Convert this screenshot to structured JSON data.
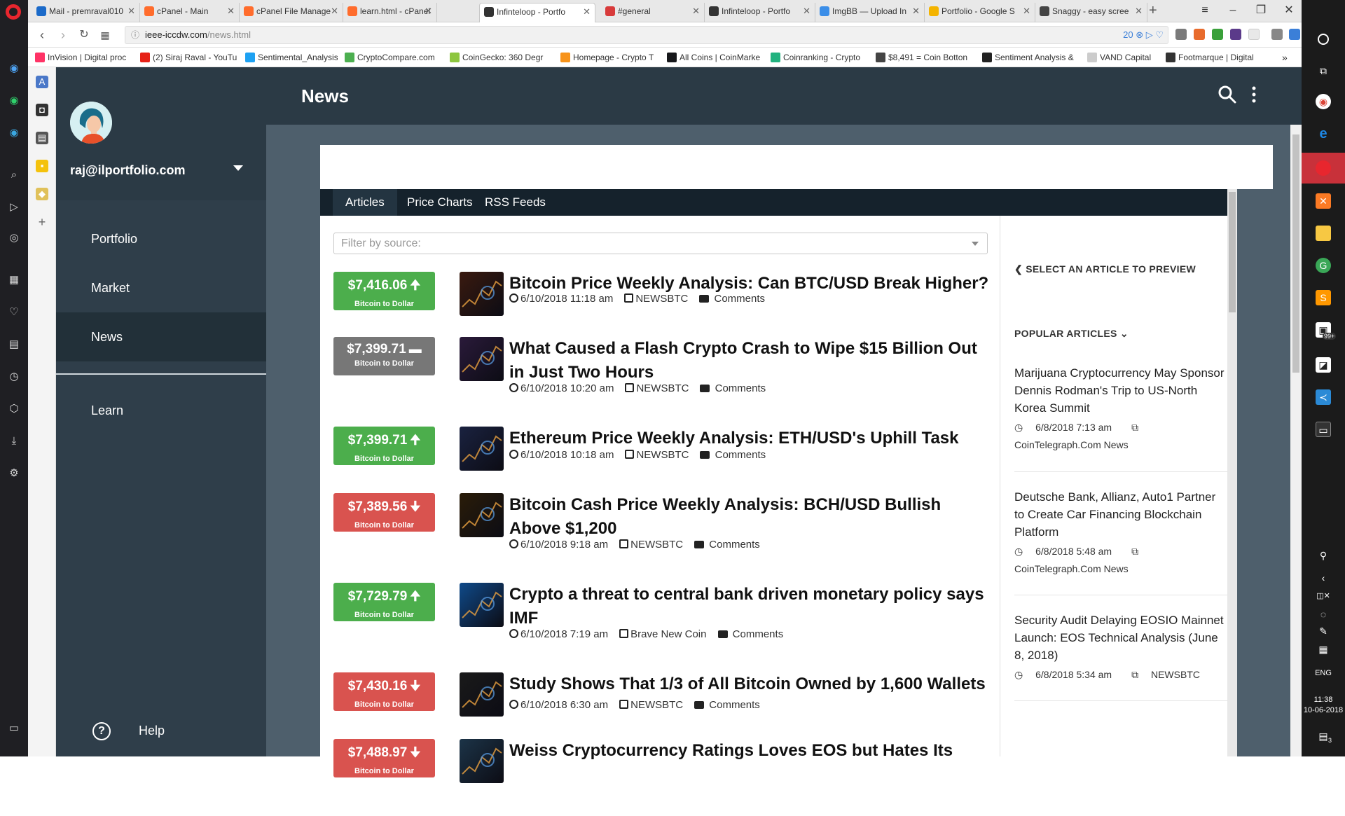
{
  "browser": {
    "tabs": [
      {
        "title": "Mail - premraval010",
        "fav": "#1b6ac9"
      },
      {
        "title": "cPanel - Main",
        "fav": "#ff6c2c"
      },
      {
        "title": "cPanel File Manage",
        "fav": "#ff6c2c"
      },
      {
        "title": "learn.html - cPanel",
        "fav": "#ff6c2c"
      },
      {
        "title": "Infinteloop - Portfo",
        "fav": "#333333"
      },
      {
        "title": "#general",
        "fav": "#d83b3b"
      },
      {
        "title": "Infinteloop - Portfo",
        "fav": "#333333"
      },
      {
        "title": "ImgBB — Upload In",
        "fav": "#3b8ee8"
      },
      {
        "title": "Portfolio - Google S",
        "fav": "#f4b400"
      },
      {
        "title": "Snaggy - easy scree",
        "fav": "#444444"
      }
    ],
    "url_host": "ieee-iccdw.com",
    "url_path": "/news.html",
    "url_extras": "20",
    "bookmarks": [
      {
        "label": "InVision | Digital proc",
        "fav": "#ff3366"
      },
      {
        "label": "(2) Siraj Raval - YouTu",
        "fav": "#e62117"
      },
      {
        "label": "Sentimental_Analysis",
        "fav": "#1da1f2"
      },
      {
        "label": "CryptoCompare.com",
        "fav": "#4caf50"
      },
      {
        "label": "CoinGecko: 360 Degr",
        "fav": "#8dc63f"
      },
      {
        "label": "Homepage - Crypto T",
        "fav": "#f7931a"
      },
      {
        "label": "All Coins | CoinMarke",
        "fav": "#17181b"
      },
      {
        "label": "Coinranking - Crypto",
        "fav": "#21b27f"
      },
      {
        "label": "$8,491 = Coin Botton",
        "fav": "#444444"
      },
      {
        "label": "Sentiment Analysis &",
        "fav": "#222222"
      },
      {
        "label": "VAND Capital",
        "fav": "#cccccc"
      },
      {
        "label": "Footmarque | Digital",
        "fav": "#333333"
      }
    ]
  },
  "app": {
    "user_email": "raj@ilportfolio.com",
    "nav": [
      "Portfolio",
      "Market",
      "News",
      "Learn"
    ],
    "help_label": "Help",
    "help_icon_text": "?",
    "page_title": "News"
  },
  "content": {
    "tabs": [
      "Articles",
      "Price Charts",
      "RSS Feeds"
    ],
    "filter_placeholder": "Filter by source:",
    "articles": [
      {
        "price": "$7,416.06",
        "trend": "up",
        "pair": "Bitcoin to Dollar",
        "headline": "Bitcoin Price Weekly Analysis: Can BTC/USD Break Higher?",
        "time": "6/10/2018 11:18 am",
        "source": "NEWSBTC",
        "comments": "Comments",
        "thumb": "#3a1a0f"
      },
      {
        "price": "$7,399.71",
        "trend": "flat",
        "pair": "Bitcoin to Dollar",
        "headline": "What Caused a Flash Crypto Crash to Wipe $15 Billion Out in Just Two Hours",
        "time": "6/10/2018 10:20 am",
        "source": "NEWSBTC",
        "comments": "Comments",
        "thumb": "#2a1a3a"
      },
      {
        "price": "$7,399.71",
        "trend": "up",
        "pair": "Bitcoin to Dollar",
        "headline": "Ethereum Price Weekly Analysis: ETH/USD's Uphill Task",
        "time": "6/10/2018 10:18 am",
        "source": "NEWSBTC",
        "comments": "Comments",
        "thumb": "#1a2240"
      },
      {
        "price": "$7,389.56",
        "trend": "down",
        "pair": "Bitcoin to Dollar",
        "headline": "Bitcoin Cash Price Weekly Analysis: BCH/USD Bullish Above $1,200",
        "time": "6/10/2018 9:18 am",
        "source": "NEWSBTC",
        "comments": "Comments",
        "thumb": "#2a1c08"
      },
      {
        "price": "$7,729.79",
        "trend": "up",
        "pair": "Bitcoin to Dollar",
        "headline": "Crypto a threat to central bank driven monetary policy says IMF",
        "time": "6/10/2018 7:19 am",
        "source": "Brave New Coin",
        "comments": "Comments",
        "thumb": "#0f4a8a"
      },
      {
        "price": "$7,430.16",
        "trend": "down",
        "pair": "Bitcoin to Dollar",
        "headline": "Study Shows That 1/3 of All Bitcoin Owned by 1,600 Wallets",
        "time": "6/10/2018 6:30 am",
        "source": "NEWSBTC",
        "comments": "Comments",
        "thumb": "#1a1a1a"
      },
      {
        "price": "$7,488.97",
        "trend": "down",
        "pair": "Bitcoin to Dollar",
        "headline": "Weiss Cryptocurrency Ratings Loves EOS but Hates Its",
        "time": "",
        "source": "",
        "comments": "",
        "thumb": "#1c3448"
      }
    ],
    "preview_hint": "SELECT AN ARTICLE TO PREVIEW",
    "popular_title": "POPULAR ARTICLES",
    "popular": [
      {
        "title": "Marijuana Cryptocurrency May Sponsor Dennis Rodman's Trip to US-North Korea Summit",
        "time": "6/8/2018 7:13 am",
        "source": "CoinTelegraph.Com News"
      },
      {
        "title": "Deutsche Bank, Allianz, Auto1 Partner to Create Car Financing Blockchain Platform",
        "time": "6/8/2018 5:48 am",
        "source": "CoinTelegraph.Com News"
      },
      {
        "title": "Security Audit Delaying EOSIO Mainnet Launch: EOS Technical Analysis (June 8, 2018)",
        "time": "6/8/2018 5:34 am",
        "source": "NEWSBTC"
      }
    ]
  },
  "taskbar": {
    "notification_badge": "99+",
    "language": "ENG",
    "time": "11:38",
    "date": "10-06-2018",
    "action_center_count": "3"
  }
}
